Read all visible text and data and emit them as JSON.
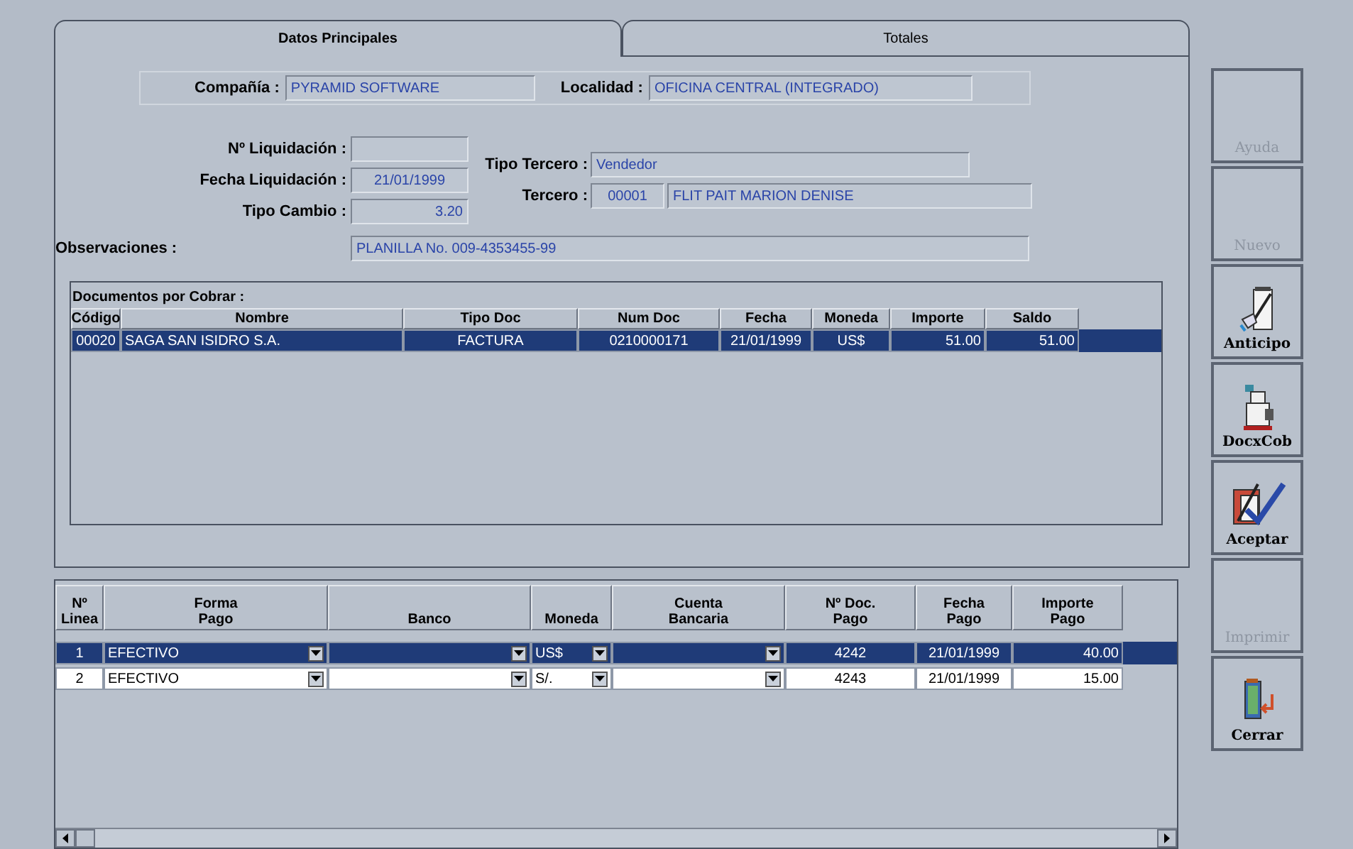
{
  "tabs": [
    {
      "label": "Datos Principales",
      "selected": true
    },
    {
      "label": "Totales",
      "selected": false
    }
  ],
  "company": {
    "label": "Compañía :",
    "value": "PYRAMID SOFTWARE"
  },
  "location": {
    "label": "Localidad :",
    "value": "OFICINA CENTRAL (INTEGRADO)"
  },
  "liquidation_number": {
    "label": "Nº Liquidación :"
  },
  "liquidation_date": {
    "label": "Fecha Liquidación :",
    "value": "21/01/1999"
  },
  "exchange_rate": {
    "label": "Tipo Cambio :",
    "value": "3.20"
  },
  "third_party_type": {
    "label": "Tipo Tercero :",
    "value": "Vendedor"
  },
  "third_party": {
    "label": "Tercero :",
    "code": "00001",
    "name": "FLIT PAIT MARION DENISE"
  },
  "remarks": {
    "label": "Observaciones :",
    "value": "PLANILLA No. 009-4353455-99"
  },
  "documents": {
    "title": "Documentos por Cobrar :",
    "columns": [
      "Código",
      "Nombre",
      "Tipo Doc",
      "Num Doc",
      "Fecha",
      "Moneda",
      "Importe",
      "Saldo"
    ],
    "rows": [
      {
        "cells": [
          "00020",
          "SAGA SAN ISIDRO S.A.",
          "FACTURA",
          "0210000171",
          "21/01/1999",
          "US$",
          "51.00",
          "51.00"
        ],
        "selected": true
      }
    ]
  },
  "payments": {
    "columns": [
      [
        "Nº",
        "Linea"
      ],
      [
        "Forma",
        "Pago"
      ],
      [
        "Banco"
      ],
      [
        "Moneda"
      ],
      [
        "Cuenta",
        "Bancaria"
      ],
      [
        "Nº Doc.",
        "Pago"
      ],
      [
        "Fecha",
        "Pago"
      ],
      [
        "Importe",
        "Pago"
      ]
    ],
    "rows": [
      {
        "line": "1",
        "payment_form": "EFECTIVO",
        "currency": "US$",
        "doc_number": "4242",
        "date": "21/01/1999",
        "amount": "40.00",
        "selected": true
      },
      {
        "line": "2",
        "payment_form": "EFECTIVO",
        "currency": "S/.",
        "doc_number": "4243",
        "date": "21/01/1999",
        "amount": "15.00",
        "selected": false
      }
    ]
  },
  "buttons": [
    {
      "label": "Ayuda",
      "kind": "text",
      "disabled": true
    },
    {
      "label": "Nuevo",
      "kind": "text",
      "disabled": true
    },
    {
      "label": "Anticipo",
      "kind": "clipboard",
      "disabled": false
    },
    {
      "label": "DocxCob",
      "kind": "machine",
      "disabled": false
    },
    {
      "label": "Aceptar",
      "kind": "check",
      "disabled": false
    },
    {
      "label": "Imprimir",
      "kind": "text",
      "disabled": true
    },
    {
      "label": "Cerrar",
      "kind": "door",
      "disabled": false
    }
  ]
}
